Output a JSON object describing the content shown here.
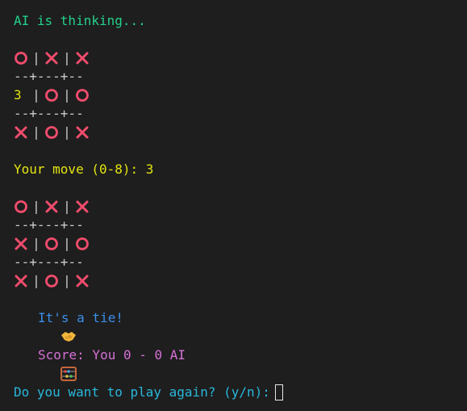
{
  "terminal": {
    "thinking_text": "AI is thinking...",
    "board_divider": "--+---+--",
    "board1": [
      [
        "O",
        "X",
        "X"
      ],
      [
        "3",
        "O",
        "O"
      ],
      [
        "X",
        "O",
        "X"
      ]
    ],
    "move_prompt": "Your move (0-8): 3",
    "board2": [
      [
        "O",
        "X",
        "X"
      ],
      [
        "X",
        "O",
        "O"
      ],
      [
        "X",
        "O",
        "X"
      ]
    ],
    "tie_text": "It's a tie!",
    "tie_icon": "handshake-icon",
    "score_text": "Score: You 0 - 0 AI",
    "score_icon": "abacus-icon",
    "play_again_prompt": "Do you want to play again? (y/n):",
    "colors": {
      "background": "#1e1e1e",
      "mark": "#f14c6c",
      "green": "#23d18b",
      "yellow": "#e5e510",
      "blue": "#3b8eea",
      "magenta": "#d670d6",
      "cyan": "#29b8db"
    }
  }
}
